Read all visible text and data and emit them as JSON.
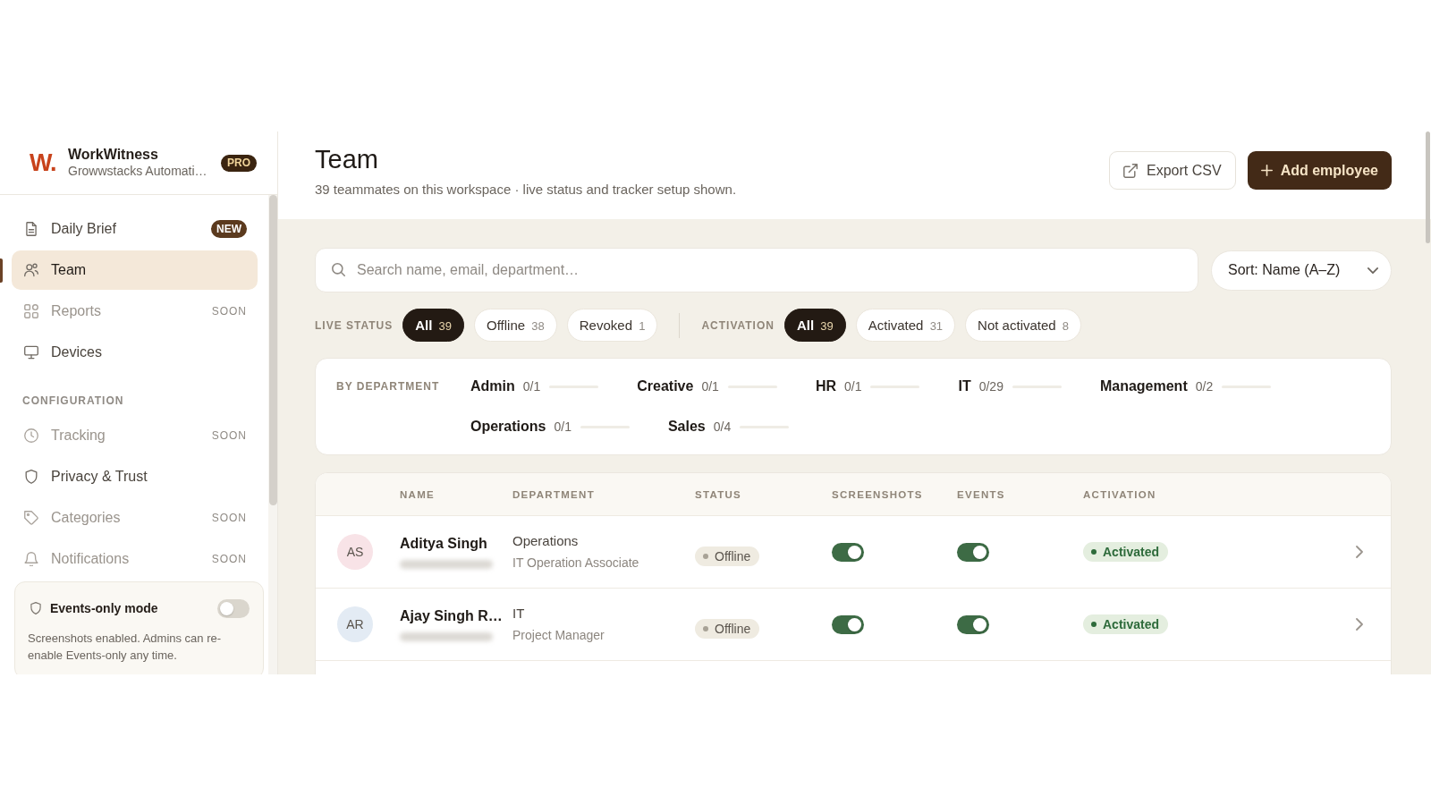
{
  "sidebar": {
    "brand": {
      "logo": "W.",
      "name": "WorkWitness",
      "workspace": "Growwstacks Automati…",
      "plan": "PRO"
    },
    "nav": [
      {
        "label": "Daily Brief",
        "badge": "NEW",
        "selected": false,
        "disabled": false
      },
      {
        "label": "Team",
        "selected": true,
        "disabled": false
      },
      {
        "label": "Reports",
        "tag": "SOON",
        "selected": false,
        "disabled": true
      },
      {
        "label": "Devices",
        "selected": false,
        "disabled": false
      }
    ],
    "section_title": "CONFIGURATION",
    "config": [
      {
        "label": "Tracking",
        "tag": "SOON",
        "selected": false,
        "disabled": true
      },
      {
        "label": "Privacy & Trust",
        "selected": false,
        "disabled": false
      },
      {
        "label": "Categories",
        "tag": "SOON",
        "selected": false,
        "disabled": true
      },
      {
        "label": "Notifications",
        "tag": "SOON",
        "selected": false,
        "disabled": true
      }
    ],
    "events_only": {
      "title": "Events-only mode",
      "on": false,
      "description": "Screenshots enabled. Admins can re-enable Events-only any time."
    }
  },
  "header": {
    "title": "Team",
    "subtitle": "39 teammates on this workspace · live status and tracker setup shown.",
    "buttons": [
      {
        "label": "Export CSV",
        "kind": "secondary"
      },
      {
        "label": "Add employee",
        "kind": "primary"
      }
    ]
  },
  "search": {
    "placeholder": "Search name, email, department…"
  },
  "sort": {
    "label": "Sort: Name (A–Z)"
  },
  "filters": [
    {
      "label": "LIVE STATUS",
      "options": [
        {
          "label": "All",
          "count": "39",
          "selected": true
        },
        {
          "label": "Offline",
          "count": "38",
          "selected": false
        },
        {
          "label": "Revoked",
          "count": "1",
          "selected": false
        }
      ]
    },
    {
      "label": "ACTIVATION",
      "options": [
        {
          "label": "All",
          "count": "39",
          "selected": true
        },
        {
          "label": "Activated",
          "count": "31",
          "selected": false
        },
        {
          "label": "Not activated",
          "count": "8",
          "selected": false
        }
      ]
    }
  ],
  "departments": {
    "title": "BY DEPARTMENT",
    "items": [
      {
        "name": "Admin",
        "count": "0/1",
        "level": 0
      },
      {
        "name": "Creative",
        "count": "0/1",
        "level": 0
      },
      {
        "name": "HR",
        "count": "0/1",
        "level": 0
      },
      {
        "name": "IT",
        "count": "0/29",
        "level": 0
      },
      {
        "name": "Management",
        "count": "0/2",
        "level": 0
      },
      {
        "name": "Operations",
        "count": "0/1",
        "level": 0
      },
      {
        "name": "Sales",
        "count": "0/4",
        "level": 0
      }
    ]
  },
  "table": {
    "columns": [
      "NAME",
      "DEPARTMENT",
      "STATUS",
      "SCREENSHOTS",
      "EVENTS",
      "ACTIVATION"
    ],
    "rows": [
      {
        "initials": "AS",
        "color": "#f8e3e7",
        "name": "Aditya Singh",
        "department": "Operations",
        "role": "IT Operation Associate",
        "status": "Offline",
        "screenshots": true,
        "events": true,
        "activation": "Activated"
      },
      {
        "initials": "AR",
        "color": "#e3ebf4",
        "name": "Ajay Singh R…",
        "department": "IT",
        "role": "Project Manager",
        "status": "Offline",
        "screenshots": true,
        "events": true,
        "activation": "Activated"
      }
    ]
  }
}
